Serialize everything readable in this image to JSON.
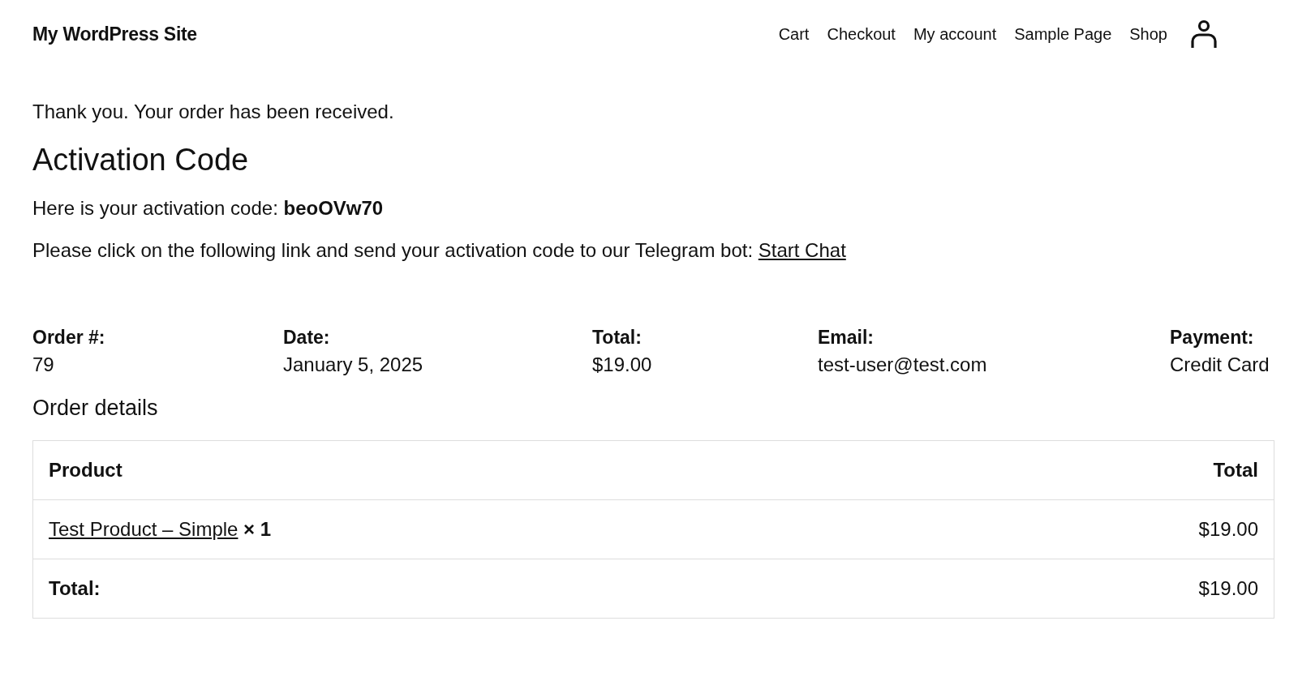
{
  "site_title": "My WordPress Site",
  "nav": [
    "Cart",
    "Checkout",
    "My account",
    "Sample Page",
    "Shop"
  ],
  "notice": "Thank you. Your order has been received.",
  "heading": "Activation Code",
  "activation_text": "Here is your activation code: **beoOVw70**",
  "telegram": {
    "text": "Please click on the following link and send your activation code to our Telegram bot:",
    "link": "Start Chat"
  },
  "overview": [
    {
      "label": "Order #:",
      "value": "79"
    },
    {
      "label": "Date:",
      "value": "January 5, 2025"
    },
    {
      "label": "Total:",
      "value": "$19.00"
    },
    {
      "label": "Email:",
      "value": "test-user@test.com"
    },
    {
      "label": "Payment:",
      "value": "Credit Card"
    }
  ],
  "order_details": {
    "title": "Order details",
    "columns": [
      "Product",
      "Total"
    ],
    "rows": [
      {
        "kind": "item",
        "product": "Test Product – Simple",
        "quantity": "× 1",
        "total": "$19.00"
      },
      {
        "kind": "total",
        "label": "Total:",
        "total": "$19.00"
      }
    ]
  }
}
